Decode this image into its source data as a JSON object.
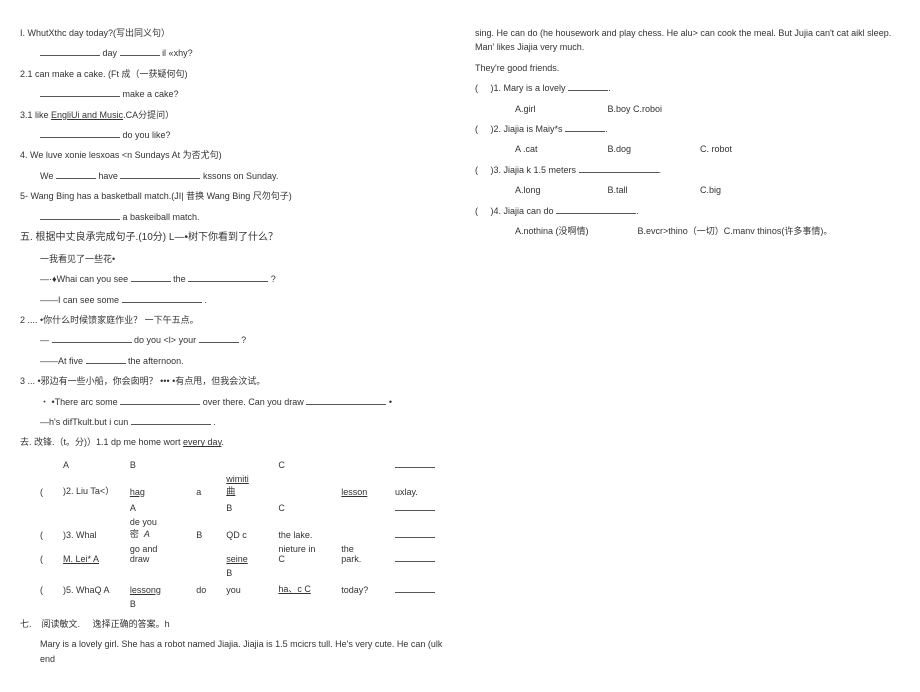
{
  "left": {
    "q1": "I. WhutXthc day today?(写出同义句）",
    "q1_blank_suffix1": "day",
    "q1_blank_suffix2": "il «xhy?",
    "q2": "2.1     can make a cake. (Ft 成（一获疑何句)",
    "q2_line2": "make a cake?",
    "q3_pre": "3.1     like ",
    "q3_u": "EngliUi and Music",
    "q3_post": ".CA分提问）",
    "q3_line2": "do you like?",
    "q4": "4. We luve xonie lesxoas <n Sundays At 为否尤句)",
    "q4a": "We",
    "q4b": "have",
    "q4c": "kssons on Sunday.",
    "q5": "5- Wang Bing has a basketball match.(JI| 昔换  Wang Bing 尺勿句子)",
    "q5_line2": "a baskeiball match.",
    "sec5": "五. 根据中丈良承完成句子.(10分)  L—•树下你看到了什么？",
    "sec5_a": "一我看见了一些花•",
    "sec5_b_pre": "—·♦Whai can you see",
    "sec5_b_mid": "the",
    "sec5_b_end": "?",
    "sec5_c": "——I can see some",
    "sec5_c_end": ".",
    "sec5_2": "2 .... •你什么时候馈家庭作业？    一下午五点。",
    "sec5_2a_pre": "—",
    "sec5_2a_mid": "do you <l> your",
    "sec5_2a_end": "?",
    "sec5_2b_pre": "——At five",
    "sec5_2b_end": "the afternoon.",
    "sec5_3": "3 ... •邪边有一些小船，你会囱明？     ••• •有点甩，但我会汶试。",
    "sec5_3a_pre": "・ •There arc some",
    "sec5_3a_mid": "over there. Can you draw",
    "sec5_3a_end": "•",
    "sec5_3b_pre": "—h's difTkult.but i cun",
    "sec5_3b_end": ".",
    "sec6_pre": "去. 改锋.（t。分)）1.1 dp me       home wort ",
    "sec6_u": "every day",
    "sec6_end": ".",
    "t": {
      "h": [
        "",
        "A",
        "B",
        "",
        "",
        "C",
        "",
        ""
      ],
      "r2": [
        "(",
        ")2. Liu Ta<）",
        "hag",
        "a",
        "wimiti 曲",
        "",
        "lesson",
        "uxlay."
      ],
      "r2b": [
        "",
        "",
        "A",
        "",
        "B",
        "C",
        "",
        ""
      ],
      "r3": [
        "(",
        ")3. Whal",
        "de you 密",
        "A",
        "B",
        "QD c",
        "the lake.",
        ""
      ],
      "r4": [
        "(",
        "M. Lei* A",
        "go and draw",
        "",
        "seine",
        "nieture in C",
        "the park.",
        ""
      ],
      "r4b": [
        "",
        "",
        "",
        "",
        "B",
        "",
        "",
        ""
      ],
      "r5": [
        "(",
        ")5. WhaQ A",
        "lessong",
        "do",
        "you",
        "ha、c C",
        "today?",
        ""
      ],
      "r5b": [
        "",
        "",
        "B",
        "",
        "",
        "",
        "",
        ""
      ]
    },
    "sec7a": "七.",
    "sec7b": "阅读敏文.",
    "sec7c": "逸择正确的答案。h",
    "passage": "Mary is a lovely girl. She has a robot named Jiajia. Jiajia is 1.5 mcicrs tull. He's very cute. He can (ulk end"
  },
  "right": {
    "passage2": "sing. He can do (he housework and play chess. He alu> can cook the meal. But Jujia can't cat aikl sleep. Man' likes Jiajia very much.",
    "passage3": "They're good friends.",
    "q1": ")1. Mary is a lovely",
    "q1a": "A.girl",
    "q1b": "B.boy C.roboi",
    "q2": ")2. Jiajia is Maiy*s",
    "q2a": "A .cat",
    "q2b": "B.dog",
    "q2c": "C. robot",
    "q3": ")3. Jiajia k 1.5 meters",
    "q3a": "A.long",
    "q3b": "B.tall",
    "q3c": "C.big",
    "q4": ")4. Jiajia can do",
    "q4a": "A.nothina (没啊情)",
    "q4b": "B.evcr>thino（一切）C.manv thinos(许多事情)。",
    "paren": "("
  }
}
